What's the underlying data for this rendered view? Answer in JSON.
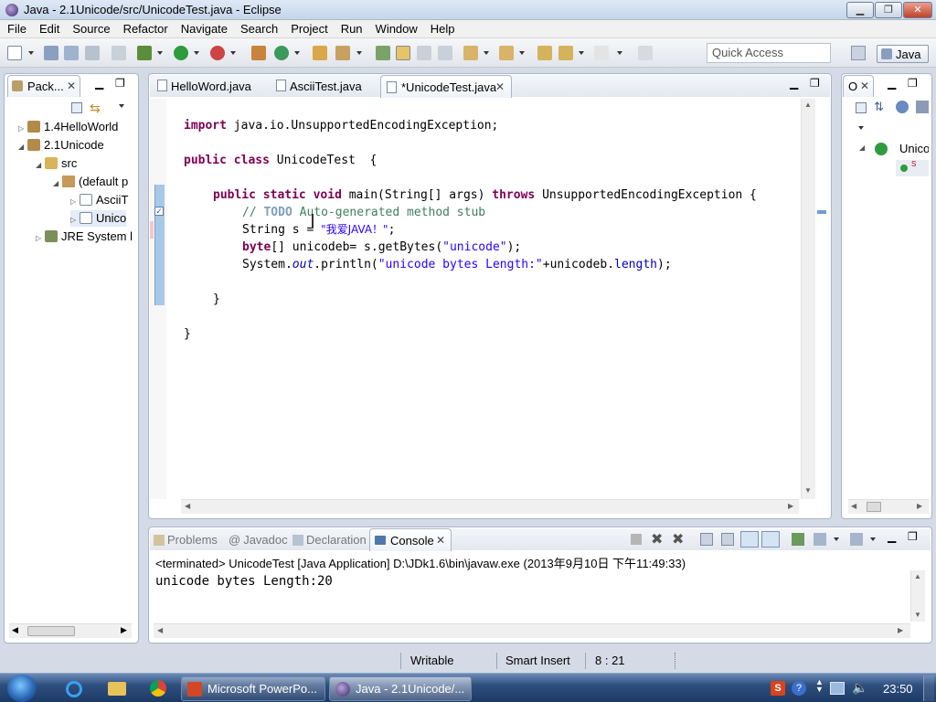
{
  "window": {
    "title": "Java - 2.1Unicode/src/UnicodeTest.java - Eclipse",
    "min": "▁",
    "max": "❐",
    "close": "✕"
  },
  "menu": [
    "File",
    "Edit",
    "Source",
    "Refactor",
    "Navigate",
    "Search",
    "Project",
    "Run",
    "Window",
    "Help"
  ],
  "toolbar": {
    "quick_access": "Quick Access",
    "perspective": "Java"
  },
  "package_explorer": {
    "tab": "Pack...",
    "items": [
      {
        "label": "1.4HelloWorld",
        "icon": "project-icon",
        "expanded": false
      },
      {
        "label": "2.1Unicode",
        "icon": "project-icon",
        "expanded": true
      },
      {
        "label": "src",
        "icon": "source-folder-icon",
        "expanded": true
      },
      {
        "label": "(default p",
        "icon": "package-icon",
        "expanded": true
      },
      {
        "label": "AsciiT",
        "icon": "java-file-icon",
        "expanded": false
      },
      {
        "label": "Unico",
        "icon": "java-file-icon",
        "expanded": false
      },
      {
        "label": "JRE System l",
        "icon": "library-icon",
        "expanded": false
      }
    ]
  },
  "editor": {
    "tabs": [
      {
        "label": "HelloWord.java",
        "active": false
      },
      {
        "label": "AsciiTest.java",
        "active": false
      },
      {
        "label": "*UnicodeTest.java",
        "active": true
      }
    ],
    "code": {
      "l1_kw": "import",
      "l1_rest": " java.io.UnsupportedEncodingException;",
      "l2_kw1": "public",
      "l2_kw2": "class",
      "l2_rest": " UnicodeTest  {",
      "l3_kw1": "public",
      "l3_kw2": "static",
      "l3_kw3": "void",
      "l3_mid": " main(String[] args) ",
      "l3_kw4": "throws",
      "l3_rest": " UnsupportedEncodingException {",
      "l4_pre": "// ",
      "l4_todo": "TODO",
      "l4_rest": " Auto-generated method stub",
      "l5_pre": "String s = ",
      "l5_str": "\"我爱JAVA！\"",
      "l5_rest": ";",
      "l6_kw": "byte",
      "l6_pre": "[] unicodeb= s.getBytes(",
      "l6_str": "\"unicode\"",
      "l6_rest": ");",
      "l7_pre": "System.",
      "l7_it": "out",
      "l7_mid": ".println(",
      "l7_str": "\"unicode bytes Length:\"",
      "l7_mid2": "+unicodeb.",
      "l7_fd": "length",
      "l7_rest": ");",
      "l8": "}",
      "l9": "}"
    }
  },
  "outline": {
    "tab": "O",
    "item": "Unico",
    "sub": "S"
  },
  "console": {
    "tabs": [
      "Problems",
      "Javadoc",
      "Declaration",
      "Console"
    ],
    "header": "<terminated> UnicodeTest [Java Application] D:\\JDk1.6\\bin\\javaw.exe (2013年9月10日 下午11:49:33)",
    "output": "unicode bytes Length:20"
  },
  "status": {
    "writable": "Writable",
    "insert": "Smart Insert",
    "position": "8 : 21"
  },
  "taskbar": {
    "tasks": [
      "Microsoft PowerPo...",
      "Java - 2.1Unicode/..."
    ],
    "clock": "23:50"
  }
}
